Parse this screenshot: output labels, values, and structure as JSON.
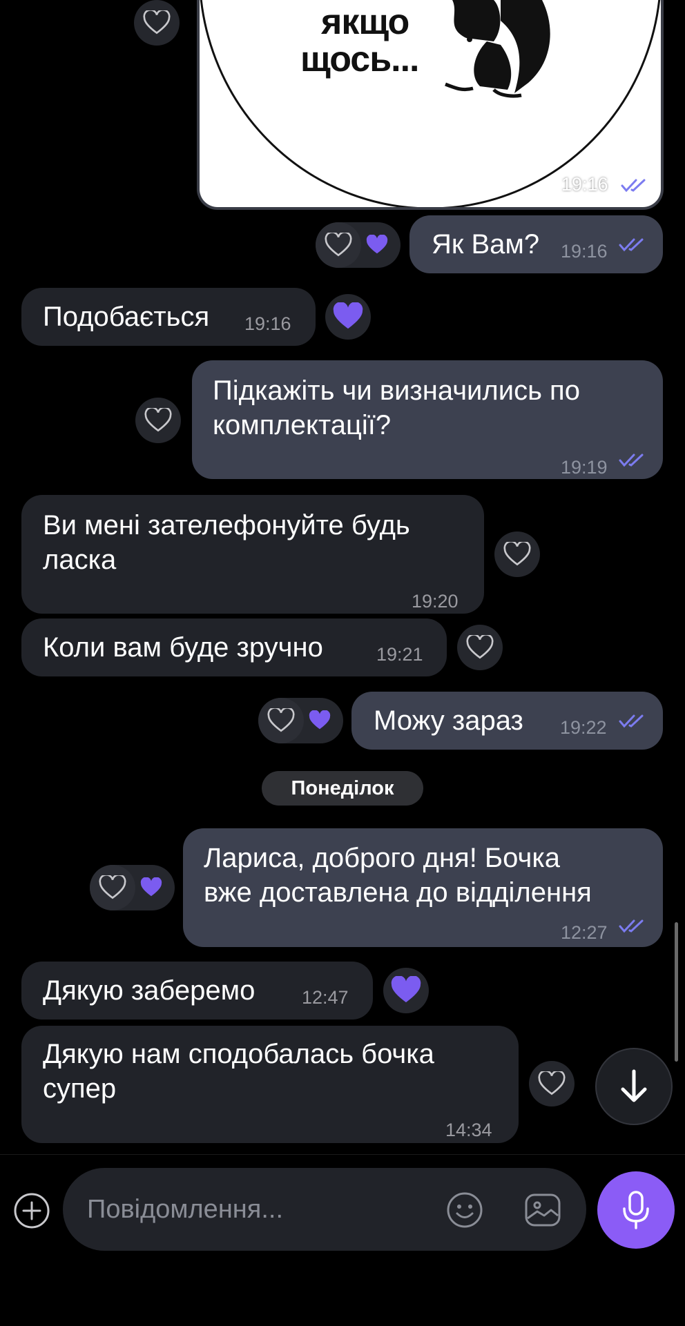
{
  "sticker": {
    "line1": "якщо",
    "line2": "щось...",
    "time": "19:16"
  },
  "messages": [
    {
      "text": "Як Вам?",
      "time": "19:16"
    },
    {
      "text": "Подобається",
      "time": "19:16"
    },
    {
      "line1": "Підкажіть чи визначились по",
      "line2": "комплектації?",
      "time": "19:19"
    },
    {
      "line1": "Ви мені зателефонуйте будь",
      "line2": "ласка",
      "time": "19:20"
    },
    {
      "text": "Коли вам буде зручно",
      "time": "19:21"
    },
    {
      "text": "Можу зараз",
      "time": "19:22"
    },
    {
      "line1": "Лариса, доброго дня! Бочка",
      "line2": "вже доставлена до відділення",
      "time": "12:27"
    },
    {
      "text": "Дякую заберемо",
      "time": "12:47"
    },
    {
      "line1": "Дякую нам сподобалась бочка",
      "line2": "супер",
      "time": "14:34"
    }
  ],
  "day_separator": "Понеділок",
  "composer": {
    "placeholder": "Повідомлення..."
  },
  "colors": {
    "accent": "#8b5cf6",
    "heart": "#7b5cf0",
    "incoming_bubble": "#212329",
    "outgoing_bubble": "#3d4150",
    "read_ticks": "#7c7cf0"
  },
  "icons": [
    "heart-outline-icon",
    "heart-filled-icon",
    "double-check-icon",
    "arrow-down-icon",
    "plus-circle-icon",
    "emoji-icon",
    "sticker-icon",
    "microphone-icon"
  ]
}
